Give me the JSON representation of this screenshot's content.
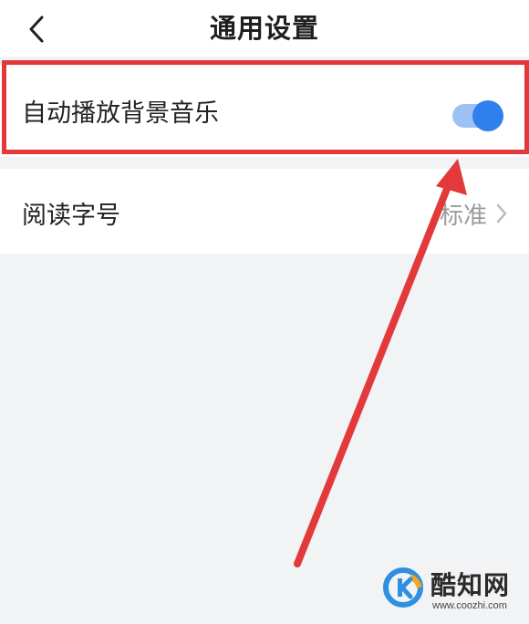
{
  "header": {
    "title": "通用设置",
    "back_icon": "chevron-left-icon"
  },
  "settings": {
    "autoplay": {
      "label": "自动播放背景音乐",
      "enabled": true,
      "toggle_color": "#2f80ed"
    },
    "font_size": {
      "label": "阅读字号",
      "value": "标准",
      "chevron_icon": "chevron-right-icon"
    }
  },
  "annotation": {
    "color": "#e23a3a",
    "arrow_icon": "red-arrow"
  },
  "watermark": {
    "name": "酷知网",
    "url": "www.coozhi.com"
  }
}
